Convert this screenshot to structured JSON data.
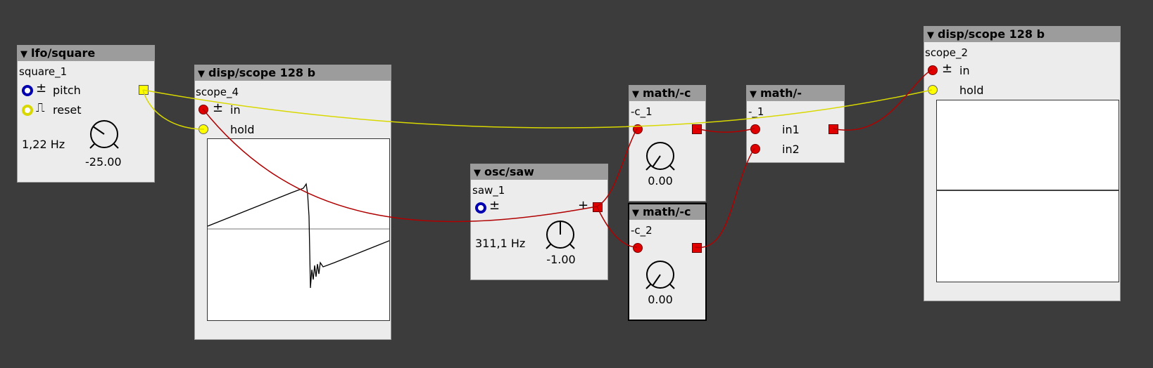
{
  "objects": {
    "lfo": {
      "type": "lfo/square",
      "name": "square_1",
      "pitch_label": "pitch",
      "reset_label": "reset",
      "freq": "1,22 Hz",
      "knob_value": "-25.00"
    },
    "scope4": {
      "type": "disp/scope 128 b",
      "name": "scope_4",
      "in_label": "in",
      "hold_label": "hold"
    },
    "saw": {
      "type": "osc/saw",
      "name": "saw_1",
      "freq": "311,1 Hz",
      "knob_value": "-1.00"
    },
    "c1": {
      "type": "math/-c",
      "name": "-c_1",
      "knob_value": "0.00"
    },
    "c2": {
      "type": "math/-c",
      "name": "-c_2",
      "knob_value": "0.00"
    },
    "minus1": {
      "type": "math/-",
      "name": "-_1",
      "in1_label": "in1",
      "in2_label": "in2"
    },
    "scope2": {
      "type": "disp/scope 128 b",
      "name": "scope_2",
      "in_label": "in",
      "hold_label": "hold"
    }
  },
  "glyphs": {
    "triangle": "▼",
    "plusminus": "±",
    "plus": "+",
    "gate": "⎍"
  },
  "colors": {
    "background": "#3c3c3c",
    "wire_audio": "#b00000",
    "wire_bool": "#d8d800",
    "port_red": "#e00000",
    "port_yellow": "#ffff00",
    "port_blue": "#0000b0"
  },
  "icons": [
    "triangle-collapse-icon",
    "knob-icon",
    "plusminus-icon",
    "gate-icon"
  ]
}
